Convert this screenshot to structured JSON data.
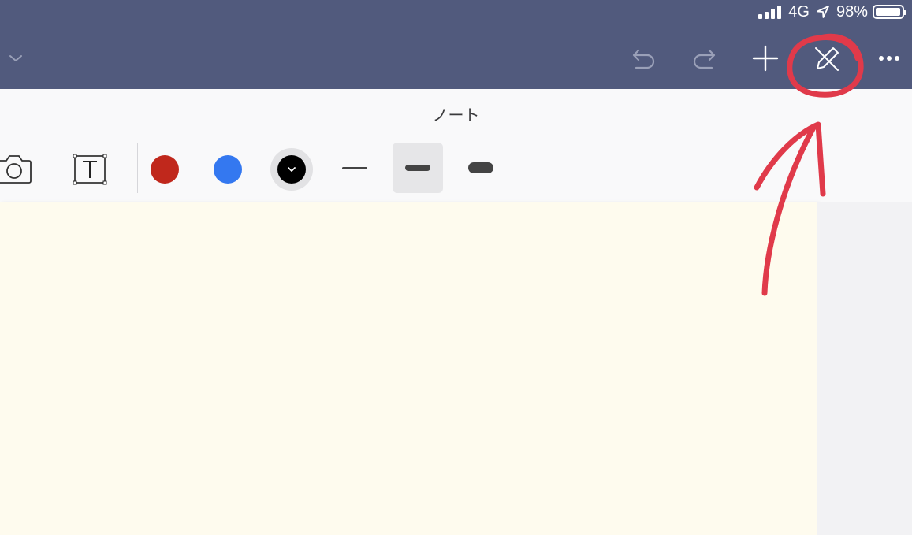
{
  "status_bar": {
    "network": "4G",
    "battery_percent": "98%",
    "battery_level": 0.98
  },
  "nav": {
    "dropdown_icon": "chevron-down-icon",
    "undo_icon": "undo-icon",
    "redo_icon": "redo-icon",
    "add_icon": "plus-icon",
    "pencil_off_icon": "pencil-off-icon",
    "more_icon": "more-icon"
  },
  "note": {
    "title": "ノート"
  },
  "toolbar": {
    "tools": [
      "camera-icon",
      "text-box-icon"
    ],
    "colors": [
      {
        "name": "red",
        "hex": "#c0281c"
      },
      {
        "name": "blue",
        "hex": "#3478f0"
      },
      {
        "name": "black",
        "hex": "#000000",
        "selected": true
      }
    ],
    "stroke_widths": [
      {
        "name": "thin",
        "selected": false
      },
      {
        "name": "medium",
        "selected": true
      },
      {
        "name": "thick",
        "selected": false
      }
    ]
  },
  "colors": {
    "header_bg": "#515a7d",
    "canvas_bg": "#fefbee",
    "annotation": "#e03a4a"
  }
}
